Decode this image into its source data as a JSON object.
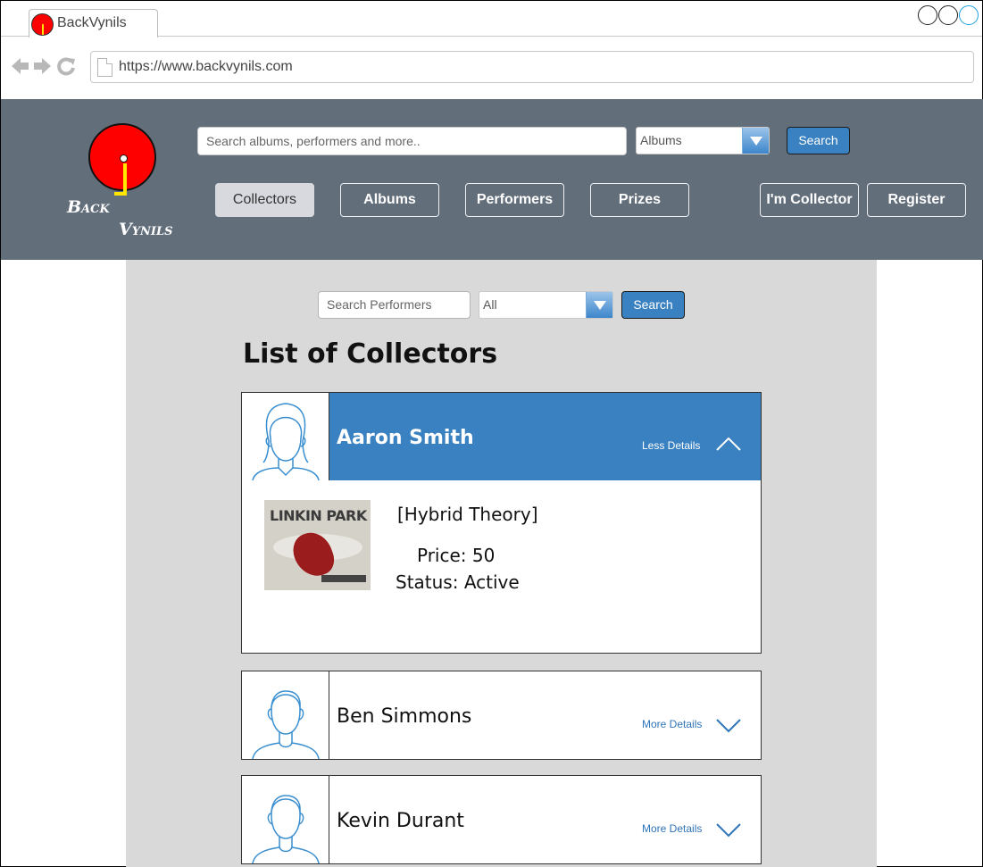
{
  "browser": {
    "tab_title": "BackVynils",
    "url": "https://www.backvynils.com",
    "nav_icons": [
      "back-arrow-icon",
      "forward-arrow-icon",
      "reload-icon",
      "page-icon"
    ]
  },
  "header": {
    "logo_line1": "Back",
    "logo_line2": "Vynils",
    "search_placeholder": "Search albums, performers and more..",
    "category_selected": "Albums",
    "search_button": "Search",
    "nav": [
      {
        "label": "Collectors",
        "active": true
      },
      {
        "label": "Albums",
        "active": false
      },
      {
        "label": "Performers",
        "active": false
      },
      {
        "label": "Prizes",
        "active": false
      }
    ],
    "account": [
      {
        "label": "I'm Collector"
      },
      {
        "label": "Register"
      }
    ]
  },
  "main": {
    "filter_placeholder": "Search Performers",
    "filter_selected": "All",
    "filter_button": "Search",
    "title": "List of Collectors",
    "collectors": [
      {
        "name": "Aaron Smith",
        "details_label": "Less Details",
        "expanded": true,
        "album": {
          "cover_text": "LINKIN PARK",
          "name": "[Hybrid Theory]",
          "price": "Price: 50",
          "status": "Status: Active"
        }
      },
      {
        "name": "Ben Simmons",
        "details_label": "More Details",
        "expanded": false
      },
      {
        "name": "Kevin Durant",
        "details_label": "More Details",
        "expanded": false
      }
    ]
  },
  "colors": {
    "header_bg": "#636e7b",
    "accent_blue": "#3a81c1",
    "panel_bg": "#d9d9d9",
    "logo_red": "#ff0000",
    "logo_yellow": "#ffe600"
  }
}
